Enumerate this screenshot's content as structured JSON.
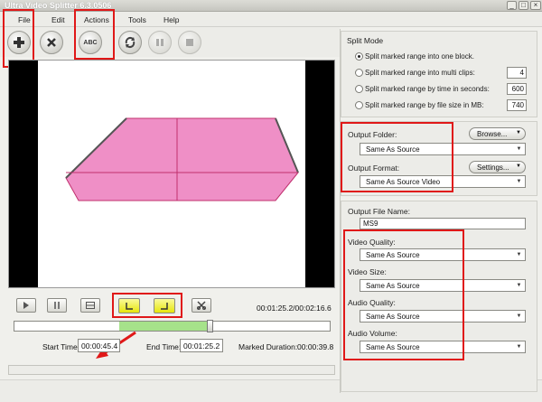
{
  "window": {
    "title": "Ultra Video Splitter 6.3.0506",
    "minimize": "_",
    "maximize": "□",
    "close": "×"
  },
  "menu": {
    "file": "File",
    "edit": "Edit",
    "actions": "Actions",
    "tools": "Tools",
    "help": "Help"
  },
  "toolbar": {
    "add_icon": "plus-icon",
    "remove_icon": "x-icon",
    "rename_label": "ABC",
    "convert_icon": "convert-icon",
    "pause_icon": "pause-icon",
    "stop_icon": "stop-icon"
  },
  "preview": {
    "colors": {
      "shape": "#ef8fc6",
      "lines": "#c0306e",
      "bars": "#000000"
    }
  },
  "controls": {
    "time_display": "00:01:25.2/00:02:16.6",
    "start_label": "Start Time:",
    "start_value": "00:00:45.4",
    "end_label": "End Time:",
    "end_value": "00:01:25.2",
    "duration_label": "Marked Duration:",
    "duration_value": "00:00:39.8",
    "slider_range": {
      "start_fraction": 0.332,
      "end_fraction": 0.622
    }
  },
  "split_mode": {
    "title": "Split Mode",
    "options": [
      {
        "label": "Split  marked range into one block.",
        "selected": true
      },
      {
        "label": "Split marked range into multi clips:",
        "value": "4"
      },
      {
        "label": "Split marked range by time in seconds:",
        "value": "600"
      },
      {
        "label": "Split marked range by file size in MB:",
        "value": "740"
      }
    ]
  },
  "output": {
    "folder_label": "Output Folder:",
    "folder_value": "Same As Source",
    "browse_label": "Browse...",
    "format_label": "Output Format:",
    "format_value": "Same As Source Video",
    "settings_label": "Settings..."
  },
  "file_settings": {
    "filename_label": "Output File Name:",
    "filename_value": "MS9",
    "video_quality_label": "Video Quality:",
    "video_quality_value": "Same As Source",
    "video_size_label": "Video Size:",
    "video_size_value": "Same As Source",
    "audio_quality_label": "Audio Quality:",
    "audio_quality_value": "Same As Source",
    "audio_volume_label": "Audio Volume:",
    "audio_volume_value": "Same As Source"
  },
  "annotation_color": "#e01818",
  "highlight_button_color": "#e6e60c"
}
